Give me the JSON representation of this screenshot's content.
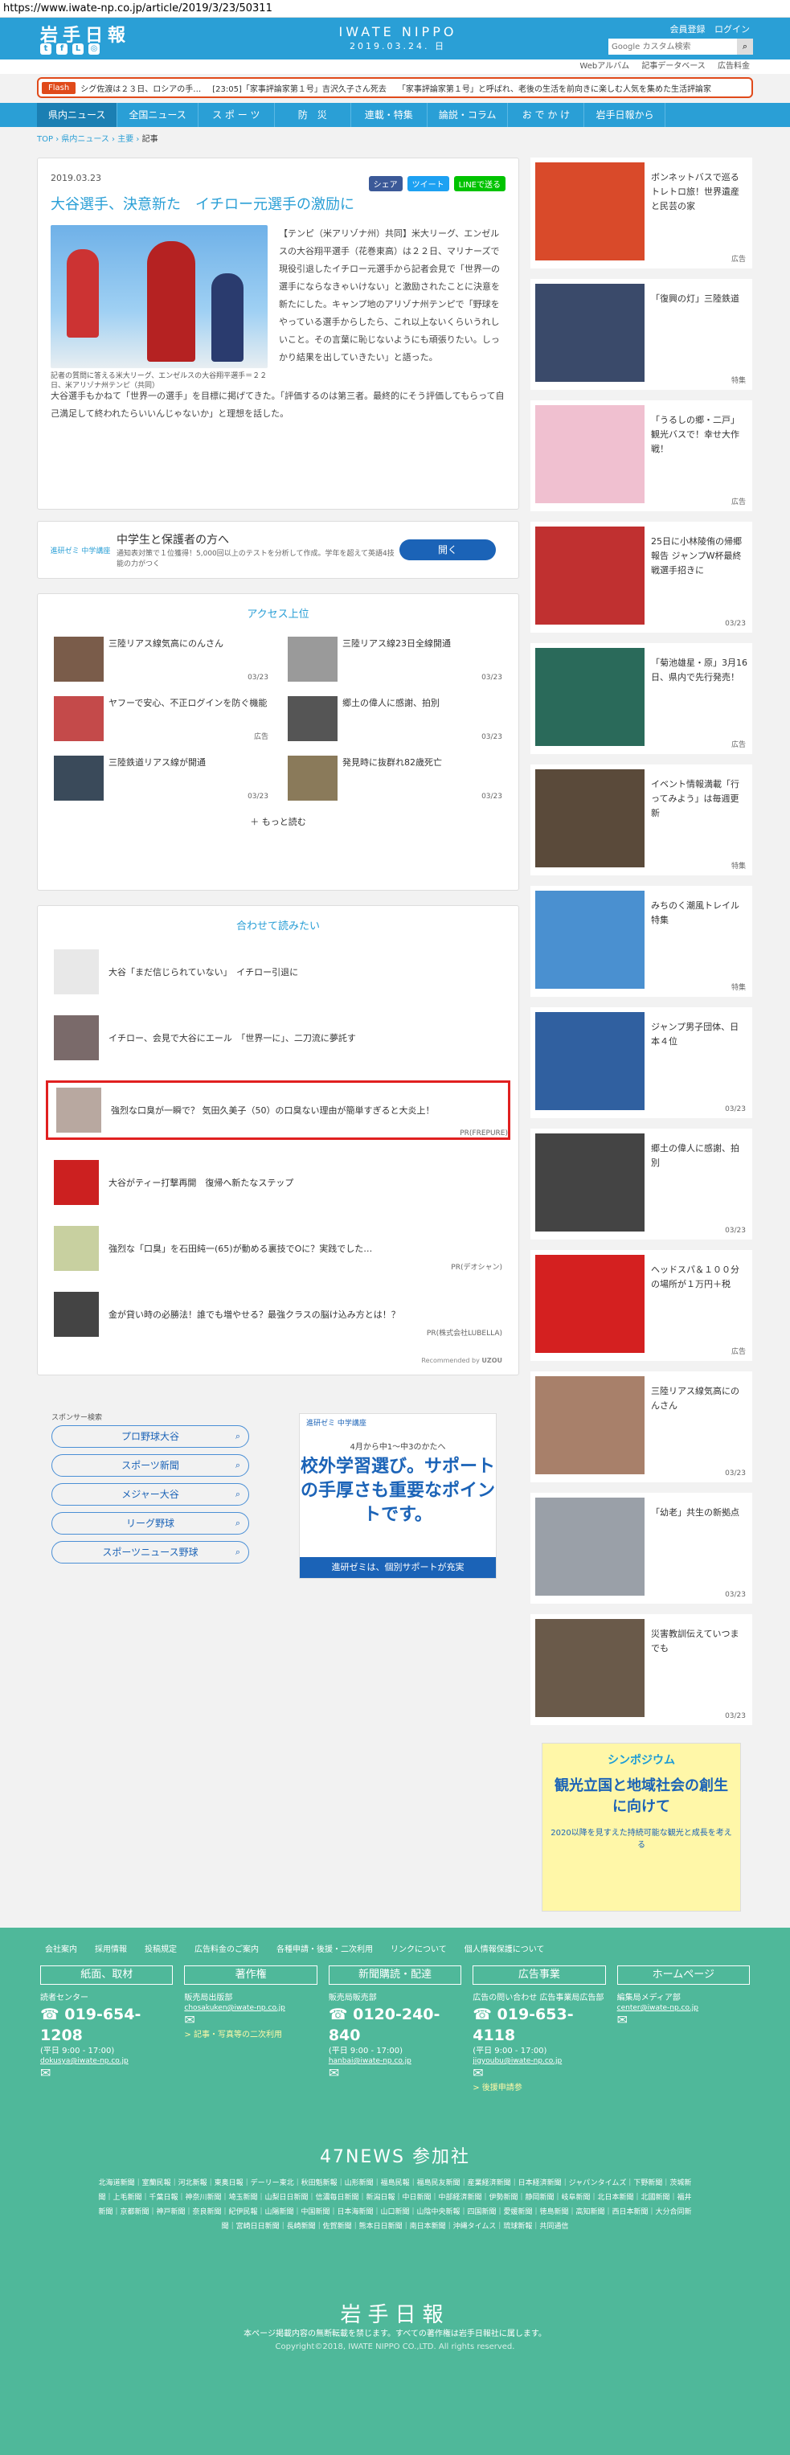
{
  "url": "https://www.iwate-np.co.jp/article/2019/3/23/50311",
  "header": {
    "logo": "岩手日報",
    "brand": "IWATE NIPPO",
    "date": "2019.03.24. 日",
    "login": [
      "会員登録",
      "ログイン"
    ],
    "search_placeholder": "Google カスタム検索",
    "sublinks": [
      "Webアルバム",
      "記事データベース",
      "広告料金"
    ]
  },
  "flash": {
    "tag": "Flash",
    "items": [
      "シグ佐渡は２３日、ロシアの手…",
      "[23:05]「家事評論家第１号」吉沢久子さん死去",
      "「家事評論家第１号」と呼ばれ、老後の生活を前向きに楽しむ人気を集めた生活評論家"
    ]
  },
  "nav": [
    "県内ニュース",
    "全国ニュース",
    "ス ポ ー ツ",
    "防　災",
    "連載・特集",
    "論説・コラム",
    "お で か け",
    "岩手日報から"
  ],
  "breadcrumb": [
    "TOP",
    "県内ニュース",
    "主要",
    "記事"
  ],
  "article": {
    "date": "2019.03.23",
    "share": [
      "シェア",
      "ツイート",
      "LINEで送る"
    ],
    "title": "大谷選手、決意新た　イチロー元選手の激励に",
    "caption": "記者の質問に答える米大リーグ、エンゼルスの大谷翔平選手＝２２日、米アリゾナ州テンピ（共同）",
    "p1": "【テンピ（米アリゾナ州）共同】米大リーグ、エンゼルスの大谷翔平選手（花巻東高）は２２日、マリナーズで現役引退したイチロー元選手から記者会見で「世界一の選手にならなきゃいけない」と激励されたことに決意を新たにした。キャンプ地のアリゾナ州テンピで「野球をやっている選手からしたら、これ以上ないくらいうれしいこと。その言葉に恥じないようにも頑張りたい。しっかり結果を出していきたい」と語った。",
    "p2": "大谷選手もかねて「世界一の選手」を目標に掲げてきた。「評価するのは第三者。最終的にそう評価してもらって自己満足して終われたらいいんじゃないか」と理想を話した。"
  },
  "ad": {
    "logo": "進研ゼミ 中学講座",
    "headline": "中学生と保護者の方へ",
    "sub": "通知表対策で１位獲得！5,000回以上のテストを分析して作成。学年を超えて英語4技能の力がつく",
    "button": "開く"
  },
  "ranking": {
    "title": "アクセス上位",
    "items": [
      {
        "title": "三陸リアス線気高にのんさん",
        "date": "03/23"
      },
      {
        "title": "三陸リアス線23日全線開通",
        "date": "03/23"
      },
      {
        "title": "ヤフーで安心、不正ログインを防ぐ機能",
        "date": "広告"
      },
      {
        "title": "郷土の偉人に感謝、拍別",
        "date": "03/23"
      },
      {
        "title": "三陸鉄道リアス線が開通",
        "date": "03/23"
      },
      {
        "title": "発見時に抜群れ82歳死亡",
        "date": "03/23"
      }
    ],
    "more": "もっと読む"
  },
  "related": {
    "title": "合わせて読みたい",
    "items": [
      {
        "title": "大谷「まだ信じられていない」　イチロー引退に",
        "pr": ""
      },
      {
        "title": "イチロー、会見で大谷にエール　「世界一に」、二刀流に夢託す",
        "pr": ""
      },
      {
        "title": "強烈な口臭が一瞬で？ 気田久美子（50）の口臭ない理由が簡単すぎると大炎上！",
        "pr": "PR(FREPURE)"
      },
      {
        "title": "大谷がティー打撃再開　復帰へ新たなステップ",
        "pr": ""
      },
      {
        "title": "強烈な「口臭」を石田純一(65)が動める裏技でOに？実践でした…",
        "pr": "PR(デオシャン)"
      },
      {
        "title": "金が貸い時の必勝法！誰でも増やせる？最強クラスの脳け込み方とは！？",
        "pr": "PR(株式会社LUBELLA)"
      }
    ],
    "rec": "Recommended by",
    "uzou": "UZOU"
  },
  "sponsor": {
    "label": "スポンサー検索",
    "keywords": [
      "プロ野球大谷",
      "スポーツ新聞",
      "メジャー大谷",
      "リーグ野球",
      "スポーツニュース野球"
    ]
  },
  "banner": {
    "top": "進研ゼミ 中学講座",
    "sub": "4月から中1〜中3のかたへ",
    "main": "校外学習選び。サポートの手厚さも重要なポイントです。",
    "foot": "進研ゼミは、個別サポートが充実"
  },
  "side": [
    {
      "title": "ボンネットバスで巡るトレトロ旅！世界遺産と民芸の家",
      "date": "広告"
    },
    {
      "title": "「復興の灯」三陸鉄道",
      "date": "特集"
    },
    {
      "title": "「うるしの郷・二戸」観光バスで！幸せ大作戦！",
      "date": "広告"
    },
    {
      "title": "25日に小林陵侑の帰郷報告 ジャンプW杯最終戦選手招きに",
      "date": "03/23"
    },
    {
      "title": "「菊池雄星・原」3月16日、県内で先行発売！",
      "date": "広告"
    },
    {
      "title": "イベント情報満載「行ってみよう」は毎週更新",
      "date": "特集"
    },
    {
      "title": "みちのく潮風トレイル特集",
      "date": "特集"
    },
    {
      "title": "ジャンプ男子団体、日本４位",
      "date": "03/23"
    },
    {
      "title": "郷土の偉人に感謝、拍別",
      "date": "03/23"
    },
    {
      "title": "ヘッドスパ＆１００分の場所が１万円＋税",
      "date": "広告"
    },
    {
      "title": "三陸リアス線気高にのんさん",
      "date": "03/23"
    },
    {
      "title": "「幼老」共生の新拠点",
      "date": "03/23"
    },
    {
      "title": "災害教訓伝えていつまでも",
      "date": "03/23"
    }
  ],
  "symposium": {
    "a": "シンポジウム",
    "b": "観光立国と地域社会の創生に向けて",
    "c": "2020以降を見すえた持続可能な観光と成長を考える"
  },
  "footer": {
    "links": [
      "会社案内",
      "採用情報",
      "投稿規定",
      "広告料金のご案内",
      "各種申請・後援・二次利用",
      "リンクについて",
      "個人情報保護について"
    ],
    "cols": [
      {
        "head": "紙面、取材",
        "label": "読者センター",
        "num": "019-654-1208",
        "hours": "(平日 9:00 - 17:00)",
        "mail": "dokusya@iwate-np.co.jp",
        "extra": ""
      },
      {
        "head": "著作権",
        "label": "販売局出版部",
        "num": "",
        "hours": "",
        "mail": "chosakuken@iwate-np.co.jp",
        "extra": "> 記事・写真等の二次利用"
      },
      {
        "head": "新聞購読・配達",
        "label": "販売局販売部",
        "num": "0120-240-840",
        "hours": "(平日 9:00 - 17:00)",
        "mail": "hanbai@iwate-np.co.jp",
        "extra": ""
      },
      {
        "head": "広告事業",
        "label": "広告の問い合わせ 広告事業局広告部",
        "num": "019-653-4118",
        "hours": "(平日 9:00 - 17:00)",
        "mail": "jigyoubu@iwate-np.co.jp",
        "extra": "> 後援申請参"
      },
      {
        "head": "ホームページ",
        "label": "編集局メディア部",
        "num": "",
        "hours": "",
        "mail": "center@iwate-np.co.jp",
        "extra": ""
      }
    ],
    "p47": "47NEWS 参加社",
    "papers": "北海道新聞｜室蘭民報｜河北新報｜東奥日報｜デーリー東北｜秋田魁新報｜山形新聞｜福島民報｜福島民友新聞｜産業経済新聞｜日本経済新聞｜ジャパンタイムズ｜下野新聞｜茨城新聞｜上毛新聞｜千葉日報｜神奈川新聞｜埼玉新聞｜山梨日日新聞｜信濃毎日新聞｜新潟日報｜中日新聞｜中部経済新聞｜伊勢新聞｜静岡新聞｜岐阜新聞｜北日本新聞｜北國新聞｜福井新聞｜京都新聞｜神戸新聞｜奈良新聞｜紀伊民報｜山陽新聞｜中国新聞｜日本海新聞｜山口新聞｜山陰中央新報｜四国新聞｜愛媛新聞｜徳島新聞｜高知新聞｜西日本新聞｜大分合同新聞｜宮崎日日新聞｜長崎新聞｜佐賀新聞｜熊本日日新聞｜南日本新聞｜沖縄タイムス｜琉球新報｜共同通信",
    "logo": "岩手日報",
    "notice": "本ページ掲載内容の無断転載を禁じます。すべての著作権は岩手日報社に属します。",
    "copy": "Copyright©2018, IWATE NIPPO CO.,LTD. All rights reserved."
  }
}
